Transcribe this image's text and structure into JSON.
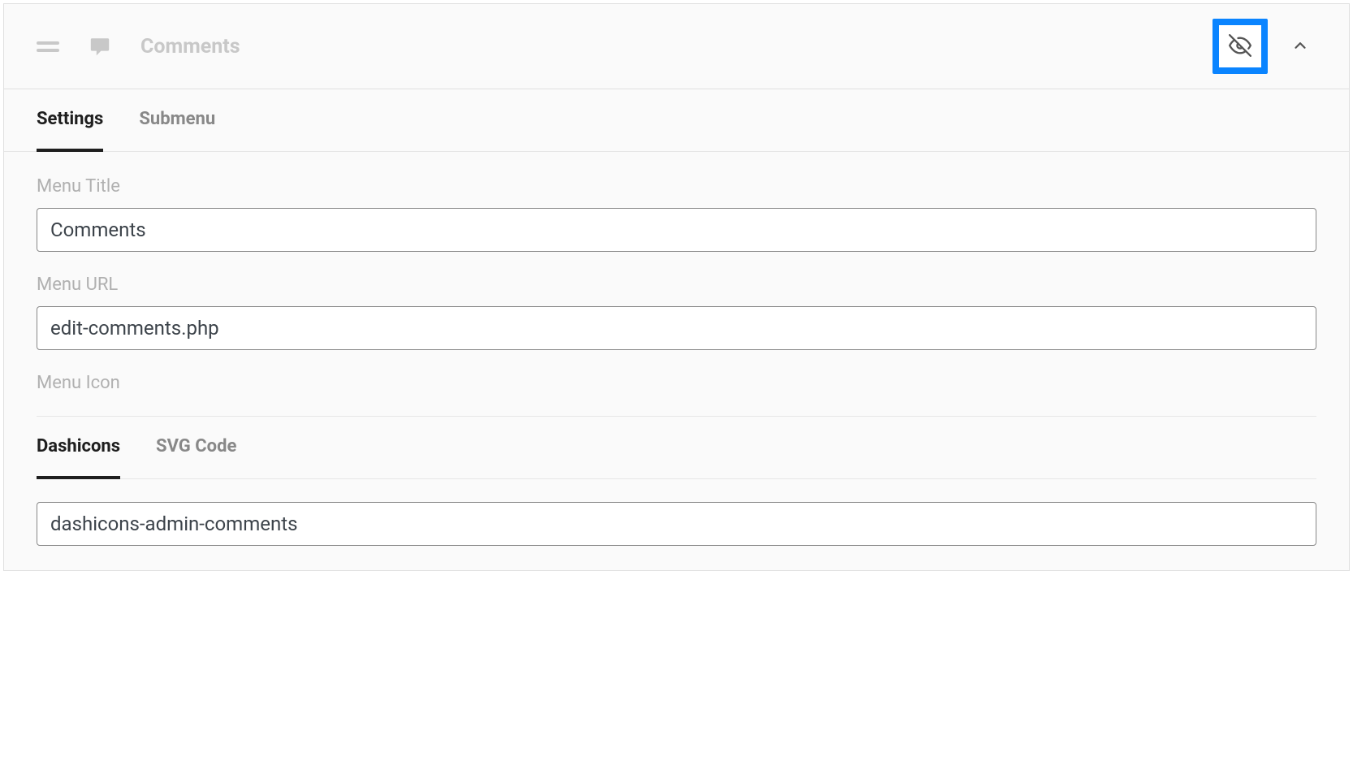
{
  "header": {
    "title": "Comments"
  },
  "tabs": {
    "settings": "Settings",
    "submenu": "Submenu"
  },
  "fields": {
    "menu_title_label": "Menu Title",
    "menu_title_value": "Comments",
    "menu_url_label": "Menu URL",
    "menu_url_value": "edit-comments.php",
    "menu_icon_label": "Menu Icon"
  },
  "icon_tabs": {
    "dashicons": "Dashicons",
    "svg_code": "SVG Code"
  },
  "icon_value": "dashicons-admin-comments"
}
